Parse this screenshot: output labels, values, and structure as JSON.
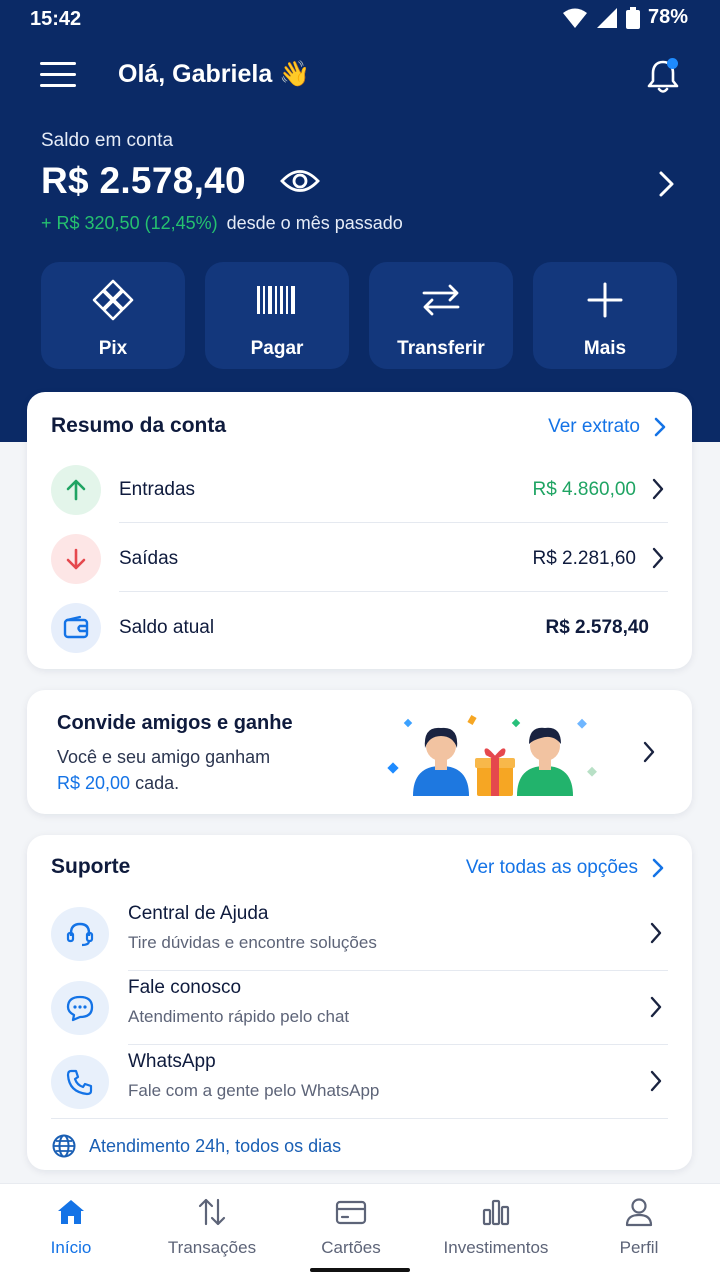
{
  "status_bar": {
    "time": "15:42",
    "battery": "78%"
  },
  "header": {
    "greeting": "Olá, Gabriela 👋"
  },
  "balance": {
    "label": "Saldo em conta",
    "value": "R$ 2.578,40",
    "delta": "+ R$ 320,50 (12,45%)",
    "delta_suffix": "desde o mês passado"
  },
  "quick_actions": [
    {
      "label": "Pix",
      "icon": "pix-icon"
    },
    {
      "label": "Pagar",
      "icon": "barcode-icon"
    },
    {
      "label": "Transferir",
      "icon": "transfer-icon"
    },
    {
      "label": "Mais",
      "icon": "plus-icon"
    }
  ],
  "summary": {
    "title": "Resumo da conta",
    "link": "Ver extrato",
    "rows": [
      {
        "label": "Entradas",
        "value": "R$ 4.860,00",
        "icon": "arrow-up-icon"
      },
      {
        "label": "Saídas",
        "value": "R$ 2.281,60",
        "icon": "arrow-down-icon"
      },
      {
        "label": "Saldo atual",
        "value": "R$ 2.578,40",
        "icon": "wallet-icon"
      }
    ]
  },
  "invite": {
    "title": "Convide amigos e ganhe",
    "line1": "Você e seu amigo ganham",
    "amount": "R$ 20,00",
    "line2_suffix": " cada."
  },
  "support": {
    "title": "Suporte",
    "link": "Ver todas as opções",
    "items": [
      {
        "title": "Central de Ajuda",
        "subtitle": "Tire dúvidas e encontre soluções",
        "icon": "headset-icon"
      },
      {
        "title": "Fale conosco",
        "subtitle": "Atendimento rápido pelo chat",
        "icon": "chat-icon"
      },
      {
        "title": "WhatsApp",
        "subtitle": "Fale com a gente pelo WhatsApp",
        "icon": "phone-icon"
      }
    ],
    "footer": "Atendimento 24h, todos os dias"
  },
  "bottom_nav": [
    {
      "label": "Início",
      "icon": "home-icon",
      "active": true
    },
    {
      "label": "Transações",
      "icon": "transactions-icon",
      "active": false
    },
    {
      "label": "Cartões",
      "icon": "card-icon",
      "active": false
    },
    {
      "label": "Investimentos",
      "icon": "chart-icon",
      "active": false
    },
    {
      "label": "Perfil",
      "icon": "profile-icon",
      "active": false
    }
  ],
  "colors": {
    "primary": "#0b2a66",
    "accent": "#1473e6",
    "positive": "#1fa463",
    "negative": "#e5484d"
  }
}
